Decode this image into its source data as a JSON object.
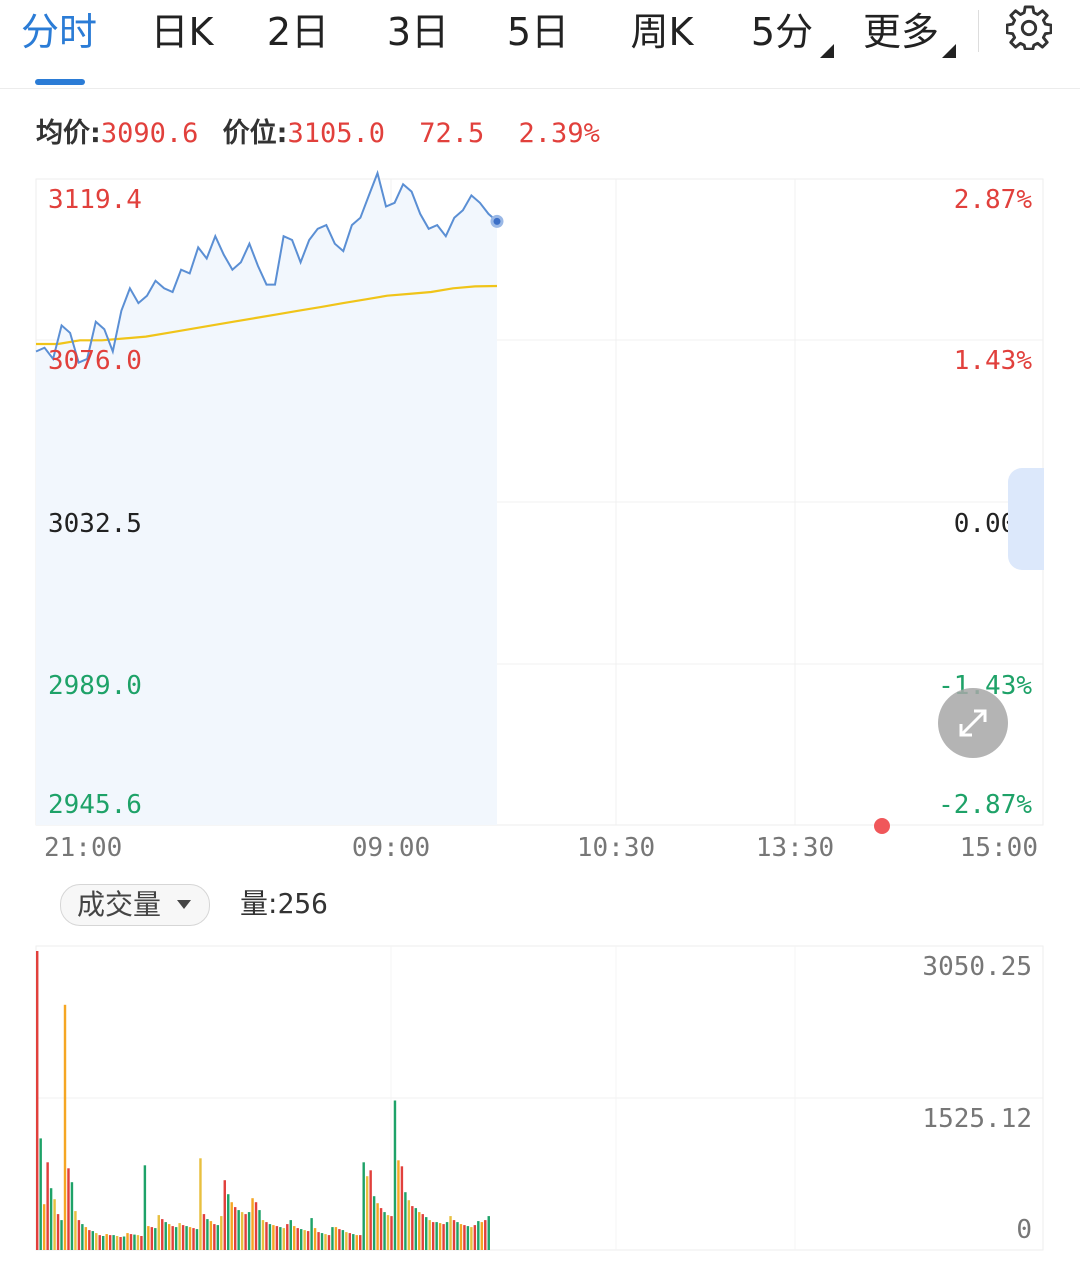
{
  "tabs": [
    {
      "label": "分时"
    },
    {
      "label": "日K"
    },
    {
      "label": "2日"
    },
    {
      "label": "3日"
    },
    {
      "label": "5日"
    },
    {
      "label": "周K"
    },
    {
      "label": "5分"
    },
    {
      "label": "更多"
    }
  ],
  "active_tab": "分时",
  "settings_icon": "gear-icon",
  "info": {
    "avg_label": "均价:",
    "avg_value": "3090.6",
    "price_label": "价位:",
    "price_value": "3105.0",
    "change": "72.5",
    "change_pct": "2.39%"
  },
  "colors": {
    "up": "#e1403c",
    "down": "#1ea268",
    "price_line": "#5b8fd4",
    "avg_line": "#f0c419",
    "accent": "#2b7cd6"
  },
  "chart_data": [
    {
      "type": "line",
      "y_ticks_left": [
        "3119.4",
        "3076.0",
        "3032.5",
        "2989.0",
        "2945.6"
      ],
      "y_ticks_right": [
        "2.87%",
        "1.43%",
        "0.00%",
        "-1.43%",
        "-2.87%"
      ],
      "x_ticks": [
        "21:00",
        "09:00",
        "10:30",
        "13:30",
        "15:00"
      ],
      "ylim": [
        2945.6,
        3119.4
      ],
      "reference_price": 3032.5,
      "series": [
        {
          "values": [
            3073,
            3074,
            3071,
            3080,
            3078,
            3070,
            3071,
            3081,
            3079,
            3073,
            3084,
            3090,
            3086,
            3088,
            3092,
            3090,
            3089,
            3095,
            3094,
            3101,
            3098,
            3104,
            3099,
            3095,
            3097,
            3102,
            3096,
            3091,
            3091,
            3104,
            3103,
            3097,
            3103,
            3106,
            3107,
            3102,
            3100,
            3107,
            3109,
            3115,
            3121,
            3112,
            3113,
            3118,
            3116,
            3110,
            3106,
            3107,
            3104,
            3109,
            3111,
            3115,
            3113,
            3110,
            3108
          ],
          "line_style": "price"
        },
        {
          "values": [
            3075,
            3075,
            3076,
            3076,
            3076.5,
            3077,
            3078,
            3079,
            3080,
            3081,
            3082,
            3083,
            3084,
            3085,
            3086,
            3087,
            3088,
            3088.5,
            3089,
            3090,
            3090.5,
            3090.6
          ],
          "line_style": "average"
        }
      ],
      "last_point_marker": true
    },
    {
      "type": "bar",
      "y_ticks_right": [
        "3050.25",
        "1525.12",
        "0"
      ],
      "ylim": [
        0,
        3050.25
      ],
      "values": [
        3000,
        1120,
        460,
        880,
        620,
        510,
        360,
        300,
        2460,
        820,
        680,
        390,
        300,
        260,
        230,
        200,
        190,
        170,
        150,
        140,
        160,
        150,
        150,
        140,
        130,
        135,
        170,
        160,
        155,
        150,
        140,
        850,
        240,
        230,
        220,
        350,
        310,
        280,
        260,
        240,
        230,
        270,
        250,
        240,
        230,
        220,
        210,
        920,
        360,
        310,
        290,
        260,
        250,
        340,
        700,
        560,
        480,
        430,
        400,
        380,
        360,
        380,
        520,
        480,
        400,
        300,
        280,
        260,
        250,
        240,
        230,
        220,
        260,
        300,
        240,
        220,
        210,
        200,
        190,
        320,
        220,
        180,
        170,
        160,
        150,
        230,
        230,
        210,
        200,
        180,
        170,
        160,
        150,
        150,
        880,
        740,
        800,
        540,
        470,
        420,
        380,
        350,
        340,
        1500,
        900,
        840,
        580,
        500,
        440,
        420,
        380,
        360,
        330,
        300,
        280,
        280,
        270,
        260,
        280,
        340,
        300,
        280,
        260,
        250,
        240,
        230,
        250,
        290,
        280,
        300,
        340
      ],
      "colors": "alternating up/down by bar",
      "last_value": "256"
    }
  ],
  "volume": {
    "selector_label": "成交量",
    "value_label": "量:",
    "value": "256"
  }
}
